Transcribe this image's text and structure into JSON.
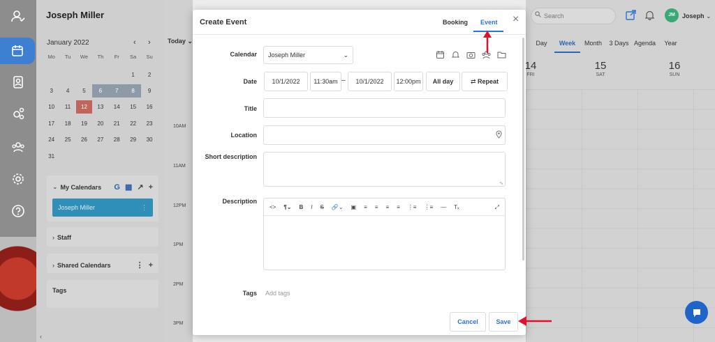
{
  "colors": {
    "accent": "#2b73d6",
    "annotation_arrow": "#e0112b",
    "today": "#c0645c",
    "calendar_item": "#2f8fb8"
  },
  "sidebar_panel": {
    "title": "Joseph Miller",
    "month": "January 2022",
    "weekdays": [
      "Mo",
      "Tu",
      "We",
      "Th",
      "Fr",
      "Sa",
      "Su"
    ],
    "weeks": [
      [
        "",
        "",
        "",
        "",
        "",
        "1",
        "2"
      ],
      [
        "3",
        "4",
        "5",
        "6",
        "7",
        "8",
        "9"
      ],
      [
        "10",
        "11",
        "12",
        "13",
        "14",
        "15",
        "16"
      ],
      [
        "17",
        "18",
        "19",
        "20",
        "21",
        "22",
        "23"
      ],
      [
        "24",
        "25",
        "26",
        "27",
        "28",
        "29",
        "30"
      ],
      [
        "31",
        "",
        "",
        "",
        "",
        "",
        ""
      ]
    ],
    "today": "12",
    "selected_week": [
      "6",
      "7",
      "8"
    ],
    "my_calendars": "My Calendars",
    "calendar_item": "Joseph Miller",
    "staff": "Staff",
    "shared_calendars": "Shared Calendars",
    "tags": "Tags"
  },
  "day_view": {
    "today_button": "Today",
    "times": [
      "10AM",
      "11AM",
      "12PM",
      "1PM",
      "2PM",
      "3PM"
    ]
  },
  "topbar": {
    "search_placeholder": "Search",
    "avatar_initials": "JM",
    "user_name": "Joseph"
  },
  "views": [
    "Day",
    "Week",
    "Month",
    "3 Days",
    "Agenda",
    "Year"
  ],
  "active_view": "Week",
  "days": [
    {
      "num": "14",
      "name": "FRI"
    },
    {
      "num": "15",
      "name": "SAT"
    },
    {
      "num": "16",
      "name": "SUN"
    }
  ],
  "modal": {
    "title": "Create Event",
    "tabs": [
      "Booking",
      "Event"
    ],
    "active_tab": "Event",
    "labels": {
      "calendar": "Calendar",
      "date": "Date",
      "title": "Title",
      "location": "Location",
      "short_description": "Short description",
      "description": "Description",
      "tags": "Tags"
    },
    "calendar_value": "Joseph Miller",
    "start_date": "10/1/2022",
    "start_time": "11:30am",
    "end_date": "10/1/2022",
    "end_time": "12:00pm",
    "all_day": "All day",
    "repeat": "Repeat",
    "tags_placeholder": "Add tags",
    "cancel": "Cancel",
    "save": "Save"
  }
}
